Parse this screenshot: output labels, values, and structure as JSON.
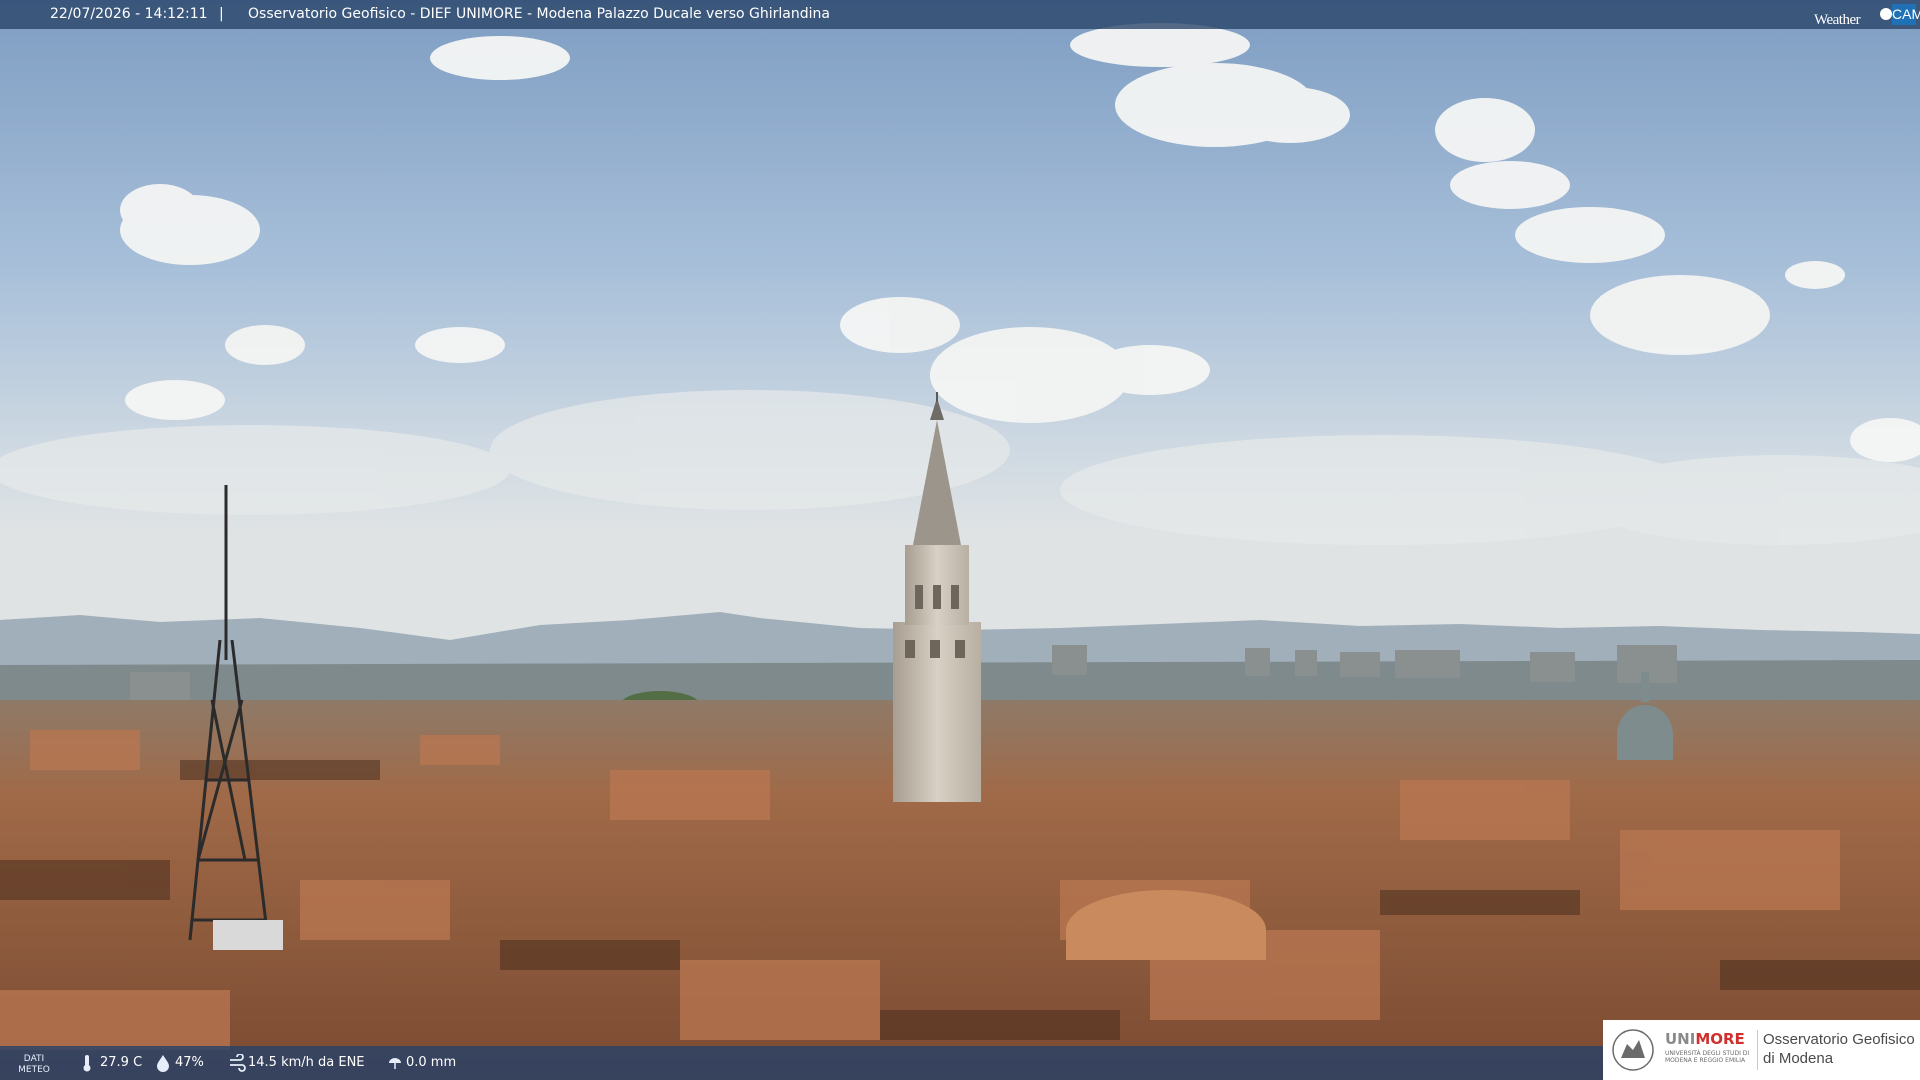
{
  "header": {
    "datetime": "22/07/2026 - 14:12:11",
    "separator": "|",
    "caption": "Osservatorio Geofisico - DIEF UNIMORE - Modena Palazzo Ducale verso Ghirlandina",
    "brand_left": "Weather",
    "brand_right": "CAM",
    "brand_color": "#1f71b6"
  },
  "weather": {
    "section_label_1": "DATI",
    "section_label_2": "METEO",
    "temperature": "27.9 C",
    "temperature_icon": "thermometer-icon",
    "humidity": "47%",
    "humidity_icon": "humidity-drop-icon",
    "wind": "14.5 km/h da ENE",
    "wind_icon": "wind-icon",
    "rain": "0.0 mm",
    "rain_icon": "rain-icon"
  },
  "logo": {
    "uni_part_1": "UNI",
    "uni_part_2": "MORE",
    "uni_subtitle": "UNIVERSITÀ DEGLI STUDI DI MODENA E REGGIO EMILIA",
    "org_line_1": "Osservatorio Geofisico",
    "org_line_2": "di Modena",
    "accent_color": "#d0302d"
  }
}
